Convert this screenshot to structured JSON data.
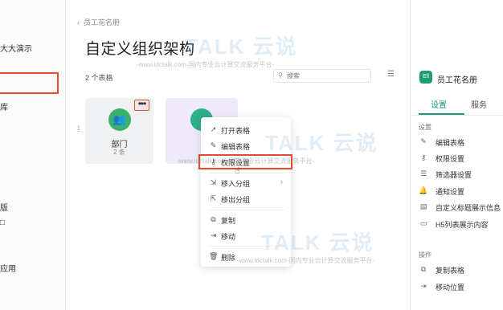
{
  "sidebar": {
    "items": [
      {
        "label": "大大演示"
      },
      {
        "label": "库"
      },
      {
        "label": "版"
      },
      {
        "label": "□"
      },
      {
        "label": "应用"
      }
    ]
  },
  "header": {
    "breadcrumb": "员工花名册",
    "title": "自定义组织架构"
  },
  "toolbar": {
    "count_text": "2 个表格",
    "search_placeholder": "搜索"
  },
  "cards": [
    {
      "name": "部门",
      "sub": "2 条",
      "more": "•••"
    }
  ],
  "menu": {
    "items": [
      {
        "label": "打开表格",
        "icon": "↗"
      },
      {
        "label": "编辑表格",
        "icon": "✎"
      },
      {
        "label": "权限设置",
        "icon": "⚷"
      },
      {
        "label": "移入分组",
        "icon": "⇲"
      },
      {
        "label": "移出分组",
        "icon": "⇱"
      },
      {
        "label": "复制",
        "icon": "⧉"
      },
      {
        "label": "移动",
        "icon": "⇥"
      },
      {
        "label": "删除",
        "icon": "🗑"
      }
    ]
  },
  "right_panel": {
    "icon_text": "Ell",
    "title": "员工花名册",
    "tabs": [
      {
        "label": "设置"
      },
      {
        "label": "服务"
      }
    ],
    "settings_section": "设置",
    "settings": [
      {
        "label": "编辑表格",
        "icon": "✎"
      },
      {
        "label": "权限设置",
        "icon": "⚷"
      },
      {
        "label": "筛选器设置",
        "icon": "☰"
      },
      {
        "label": "通知设置",
        "icon": "🔔"
      },
      {
        "label": "自定义标题展示信息",
        "icon": "▤"
      },
      {
        "label": "H5列表展示内容",
        "icon": "▭"
      }
    ],
    "ops_section": "操作",
    "operations": [
      {
        "label": "复制表格",
        "icon": "⧉"
      },
      {
        "label": "移动位置",
        "icon": "⇥"
      }
    ]
  },
  "watermark": {
    "brand": "TALK 云说",
    "url": "-www.idctalk.com-国内专业云计算交流服务平台-"
  },
  "colors": {
    "accent": "#1a9a7a",
    "highlight": "#e8492f",
    "card_avatar": "#3ab26a"
  }
}
